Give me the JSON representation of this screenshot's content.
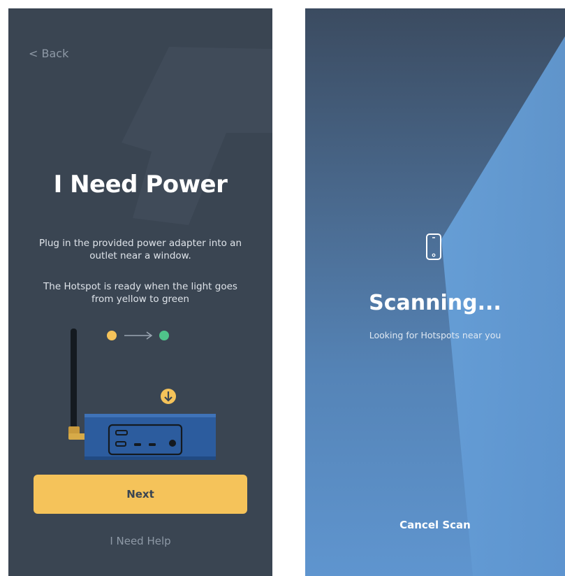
{
  "power_screen": {
    "back_label": "< Back",
    "title": "I Need Power",
    "paragraph_1": "Plug in the provided power adapter into an outlet near a window.",
    "paragraph_2": "The Hotspot is ready when the light goes from yellow to green",
    "next_label": "Next",
    "help_label": "I Need Help"
  },
  "scan_screen": {
    "title": "Scanning...",
    "subtitle": "Looking for Hotspots near you",
    "cancel_label": "Cancel Scan"
  },
  "icons": {
    "bolt": "lightning-bolt-icon",
    "arrow_right": "arrow-right-icon",
    "arrow_down": "arrow-down-icon",
    "phone": "phone-icon"
  },
  "colors": {
    "power_bg": "#3a4552",
    "accent_yellow": "#f5c35a",
    "light_green": "#4fc48a",
    "device_blue": "#2c5c9e",
    "scan_blue": "#5f95cf"
  }
}
